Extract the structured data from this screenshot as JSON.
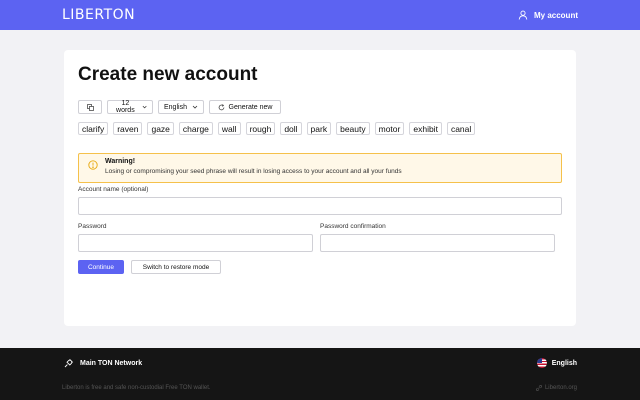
{
  "header": {
    "logo": "LIBERTON",
    "account_label": "My account",
    "accent_color": "#5c63f2"
  },
  "page": {
    "title": "Create new account"
  },
  "controls": {
    "copy_icon": "copy-icon",
    "words_select": "12 words",
    "language_select": "English",
    "generate_label": "Generate new"
  },
  "seed_words": [
    "clarify",
    "raven",
    "gaze",
    "charge",
    "wall",
    "rough",
    "doll",
    "park",
    "beauty",
    "motor",
    "exhibit",
    "canal"
  ],
  "warning": {
    "title": "Warning!",
    "text": "Losing or compromising your seed phrase will result in losing access to your account and all your funds",
    "color": "#f5c14b"
  },
  "form": {
    "account_name_label": "Account name (optional)",
    "account_name_value": "",
    "password_label": "Password",
    "password_value": "",
    "confirm_label": "Password confirmation",
    "confirm_value": "",
    "continue_label": "Continue",
    "restore_label": "Switch to restore mode"
  },
  "footer": {
    "network_label": "Main TON Network",
    "language_label": "English",
    "tagline": "Liberton is free and safe non-custodial Free TON wallet.",
    "site_link": "Liberton.org"
  }
}
